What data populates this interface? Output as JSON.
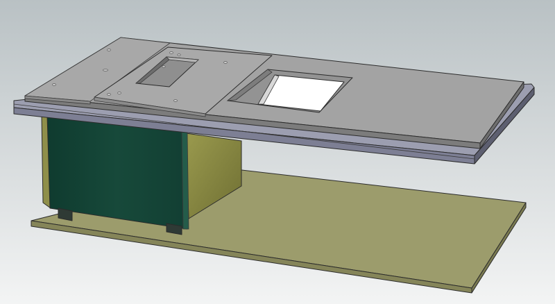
{
  "scene": {
    "background_top": "#b9c1c4",
    "background_bottom": "#f3f4f4",
    "colors": {
      "table_top": "#9e9e9e",
      "table_top_light": "#a6a6a6",
      "table_front": "#7a7a7a",
      "rail": "#8a8c9e",
      "rail_dark": "#5d5f70",
      "cabinet_front": "#17493a",
      "cabinet_side": "#8a8a43",
      "base_board": "#9c9c6c",
      "base_board_front": "#8b8b5e",
      "foot": "#2f3a35"
    },
    "parts": [
      "table-top",
      "router-plate",
      "saw-insert",
      "fence-rail",
      "cabinet",
      "base-board"
    ]
  }
}
